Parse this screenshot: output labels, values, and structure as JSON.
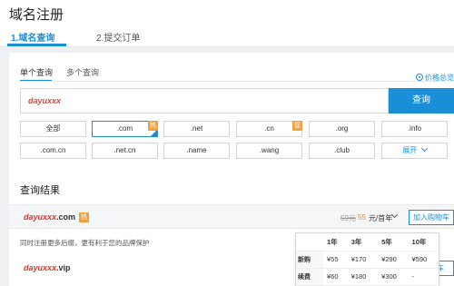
{
  "header": {
    "title": "域名注册",
    "steps": [
      {
        "label": "1.域名查询"
      },
      {
        "label": "2.提交订单"
      }
    ]
  },
  "search": {
    "tabs": [
      {
        "label": "单个查询"
      },
      {
        "label": "多个查询"
      }
    ],
    "price_link": "价格总览",
    "input_value": "dayuxxx",
    "button_label": "查询"
  },
  "tlds": [
    {
      "label": "全部"
    },
    {
      "label": ".com",
      "badge": "热",
      "selected": true
    },
    {
      "label": ".net"
    },
    {
      "label": ".cn",
      "badge": "促"
    },
    {
      "label": ".org"
    },
    {
      "label": ".info"
    },
    {
      "label": ".com.cn"
    },
    {
      "label": ".net.cn"
    },
    {
      "label": ".name"
    },
    {
      "label": ".wang"
    },
    {
      "label": ".club"
    },
    {
      "label": "展开"
    }
  ],
  "results": {
    "title": "查询结果",
    "first": {
      "name": "dayuxxx",
      "tld": ".com",
      "badge": "热",
      "price_old": "59元",
      "price_new": "55",
      "price_unit": "元/首年",
      "cart_label": "加入购物车"
    },
    "hint": "同时注册更多后缀，更有利于您的品牌保护",
    "second": {
      "name": "dayuxxx",
      "tld": ".vip",
      "cart_label": "车"
    }
  },
  "price_table": {
    "headers": [
      "",
      "1年",
      "3年",
      "5年",
      "10年"
    ],
    "rows": [
      {
        "label": "新购",
        "values": [
          "¥55",
          "¥170",
          "¥290",
          "¥590"
        ]
      },
      {
        "label": "续费",
        "values": [
          "¥60",
          "¥180",
          "¥300",
          "-"
        ]
      }
    ]
  },
  "colors": {
    "accent": "#1a8fd8",
    "badge": "#f0a23c",
    "price": "#f08a24",
    "domain": "#d8352b"
  },
  "icons": {
    "price_link": "info-circle-icon",
    "expand": "chevron-down-icon"
  }
}
